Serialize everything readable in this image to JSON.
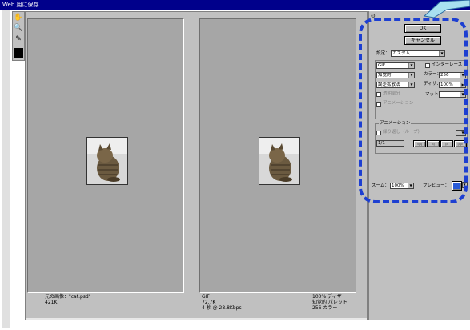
{
  "window": {
    "title": "Web 用に保存"
  },
  "tools": [
    "hand-tool",
    "zoom-tool",
    "eyedropper-tool",
    "color-swatch"
  ],
  "left_pane": {
    "format": "元の画像：\"cat.psd\"",
    "size": "421K"
  },
  "right_pane": {
    "col1_line1": "GIF",
    "col1_line2": "72.7K",
    "col1_line3": "4 秒 @ 28.8Kbps",
    "col2_line1": "100% ディザ",
    "col2_line2": "知覚的 パレット",
    "col2_line3": "256 カラー"
  },
  "side": {
    "ok_label": "OK",
    "cancel_label": "キャンセル",
    "settings_label": "設定：",
    "settings_value": "カスタム",
    "format_value": "GIF",
    "interlace_label": "インターレース",
    "reduction_value": "知覚的",
    "colors_label": "カラー：",
    "colors_value": "256",
    "dither_algo_value": "誤差拡散法",
    "dither_label": "ディザ：",
    "dither_value": "100%",
    "transparency_label": "透明部分",
    "matte_label": "マット：",
    "web_snap_label": "アニメーション",
    "animation_group_label": "アニメーション",
    "loop_label": "繰り返し（ループ）",
    "frame_label": "1/1",
    "nav_buttons": [
      "◁◁",
      "◁",
      "▷",
      "▷▷"
    ],
    "zoom_label": "ズーム：",
    "zoom_value": "100%",
    "preview_label": "プレビュー："
  },
  "accent_color": "#1d3fd1"
}
